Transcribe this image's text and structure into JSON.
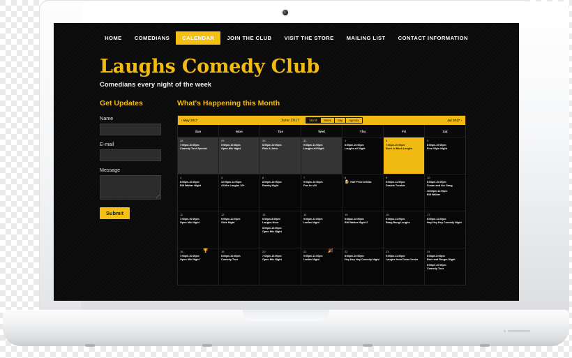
{
  "nav": {
    "items": [
      {
        "label": "HOME",
        "active": false
      },
      {
        "label": "COMEDIANS",
        "active": false
      },
      {
        "label": "CALENDAR",
        "active": true
      },
      {
        "label": "JOIN THE CLUB",
        "active": false
      },
      {
        "label": "VISIT THE STORE",
        "active": false
      },
      {
        "label": "MAILING LIST",
        "active": false
      },
      {
        "label": "CONTACT INFORMATION",
        "active": false
      }
    ]
  },
  "brand": {
    "title": "Laughs Comedy Club",
    "tagline": "Comedians every night of the week"
  },
  "form": {
    "title": "Get Updates",
    "name_label": "Name",
    "email_label": "E-mail",
    "message_label": "Message",
    "submit_label": "Submit"
  },
  "calendar_section": {
    "title": "What's Happening this Month"
  },
  "calendar": {
    "prev_label": "‹ May 2017",
    "next_label": "Jul 2017 ›",
    "month_label": "June 2017",
    "views": [
      {
        "label": "Month",
        "active": true
      },
      {
        "label": "Week",
        "active": false
      },
      {
        "label": "Day",
        "active": false
      },
      {
        "label": "Agenda",
        "active": false
      }
    ],
    "weekdays": [
      "Sun",
      "Mon",
      "Tue",
      "Wed",
      "Thu",
      "Fri",
      "Sat"
    ],
    "weeks": [
      [
        {
          "day": "28",
          "state": "other",
          "events": [
            {
              "time": "7:00pm-10:00pm",
              "name": "Comedy Tour Special"
            }
          ]
        },
        {
          "day": "29",
          "state": "other",
          "events": [
            {
              "time": "9:00pm-10:00pm",
              "name": "Open Mic Night"
            }
          ]
        },
        {
          "day": "30",
          "state": "other",
          "events": [
            {
              "time": "8:00pm-10:00pm",
              "name": "Rick & John"
            }
          ]
        },
        {
          "day": "31",
          "state": "other",
          "events": [
            {
              "time": "9:00pm-11:00pm",
              "name": "Laughs all Night"
            }
          ]
        },
        {
          "day": "1",
          "state": "normal",
          "events": [
            {
              "time": "8:00pm-10:00pm",
              "name": "Laughs all Night"
            }
          ]
        },
        {
          "day": "2",
          "state": "today",
          "events": [
            {
              "time": "7:00pm-10:00pm",
              "name": "Back to Back Laughs"
            }
          ]
        },
        {
          "day": "3",
          "state": "normal",
          "events": [
            {
              "time": "8:00pm-10:00pm",
              "name": "Free Style Night"
            }
          ]
        }
      ],
      [
        {
          "day": "4",
          "state": "normal",
          "events": [
            {
              "time": "8:00pm-10:00pm",
              "name": "Bill Walker Night"
            }
          ]
        },
        {
          "day": "5",
          "state": "normal",
          "events": [
            {
              "time": "10:00pm-11:00pm",
              "name": "All the Laughs 10+"
            }
          ]
        },
        {
          "day": "6",
          "state": "normal",
          "events": [
            {
              "time": "8:00pm-10:00pm",
              "name": "Rowdy Night"
            }
          ]
        },
        {
          "day": "7",
          "state": "normal",
          "events": [
            {
              "time": "9:00pm-10:00pm",
              "name": "Fun for All"
            }
          ]
        },
        {
          "day": "8",
          "state": "normal",
          "events": [
            {
              "time": "",
              "name": "Half Price Drinks",
              "emoji": "🍺"
            }
          ]
        },
        {
          "day": "9",
          "state": "normal",
          "events": [
            {
              "time": "9:00pm-11:00pm",
              "name": "Double Trouble"
            }
          ]
        },
        {
          "day": "10",
          "state": "normal",
          "events": [
            {
              "time": "8:00pm-10:00pm",
              "name": "Susan and the Gang"
            },
            {
              "time": "10:00pm-11:00pm",
              "name": "Bill Walker"
            }
          ]
        }
      ],
      [
        {
          "day": "11",
          "state": "normal",
          "events": [
            {
              "time": "7:00pm-10:00pm",
              "name": "Open Mic Night"
            }
          ]
        },
        {
          "day": "12",
          "state": "normal",
          "events": [
            {
              "time": "8:00pm-11:00pm",
              "name": "Girls Night"
            }
          ]
        },
        {
          "day": "13",
          "state": "normal",
          "events": [
            {
              "time": "6:00pm-8:00pm",
              "name": "Laughs Hour"
            },
            {
              "time": "8:00pm-10:00pm",
              "name": "Open Mic Night"
            }
          ]
        },
        {
          "day": "14",
          "state": "normal",
          "events": [
            {
              "time": "9:00pm-11:00pm",
              "name": "Ladies Night"
            }
          ]
        },
        {
          "day": "15",
          "state": "normal",
          "events": [
            {
              "time": "8:00pm-10:00pm",
              "name": "Bill Walker Night 2"
            }
          ]
        },
        {
          "day": "16",
          "state": "normal",
          "events": [
            {
              "time": "9:00pm-11:00pm",
              "name": "Bang Bang Laughs"
            }
          ]
        },
        {
          "day": "17",
          "state": "normal",
          "events": [
            {
              "time": "8:00pm-11:00pm",
              "name": "Hey Hey Hey Comedy Night"
            }
          ]
        }
      ],
      [
        {
          "day": "18",
          "state": "normal",
          "emoji": "🏆",
          "events": [
            {
              "time": "7:00pm-10:00pm",
              "name": "Open Mic Night"
            }
          ]
        },
        {
          "day": "19",
          "state": "normal",
          "events": [
            {
              "time": "8:00pm-10:00pm",
              "name": "Comedy Tour"
            }
          ]
        },
        {
          "day": "20",
          "state": "normal",
          "events": [
            {
              "time": "7:00pm-10:00pm",
              "name": "Open Mic Night"
            }
          ]
        },
        {
          "day": "21",
          "state": "normal",
          "emoji": "🎉",
          "events": [
            {
              "time": "9:00pm-11:00pm",
              "name": "Ladies Night"
            }
          ]
        },
        {
          "day": "22",
          "state": "normal",
          "events": [
            {
              "time": "8:00pm-10:00pm",
              "name": "Hey Hey Hey Comedy Night"
            }
          ]
        },
        {
          "day": "23",
          "state": "normal",
          "events": [
            {
              "time": "9:00pm-11:00pm",
              "name": "Laughs from Down Under"
            }
          ]
        },
        {
          "day": "24",
          "state": "normal",
          "events": [
            {
              "time": "6:00pm-8:00pm",
              "name": "Beer and Burger Night"
            },
            {
              "time": "8:00pm-10:00pm",
              "name": "Comedy Tour"
            }
          ]
        }
      ]
    ]
  },
  "colors": {
    "accent": "#f2bb13",
    "toolbar": "#f0ba12",
    "screen_bg": "#0b0b0b"
  }
}
